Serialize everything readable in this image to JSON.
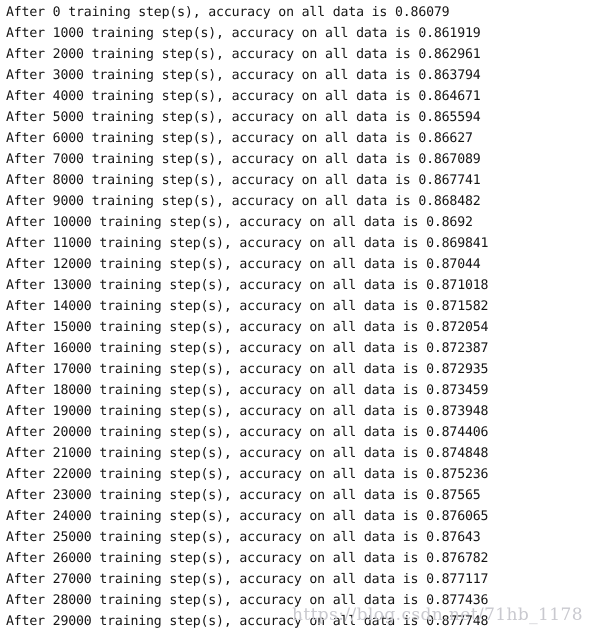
{
  "console": {
    "prefix": "After ",
    "middle": " training step(s), accuracy on all data is ",
    "lines": [
      "After 0 training step(s), accuracy on all data is 0.86079",
      "After 1000 training step(s), accuracy on all data is 0.861919",
      "After 2000 training step(s), accuracy on all data is 0.862961",
      "After 3000 training step(s), accuracy on all data is 0.863794",
      "After 4000 training step(s), accuracy on all data is 0.864671",
      "After 5000 training step(s), accuracy on all data is 0.865594",
      "After 6000 training step(s), accuracy on all data is 0.86627",
      "After 7000 training step(s), accuracy on all data is 0.867089",
      "After 8000 training step(s), accuracy on all data is 0.867741",
      "After 9000 training step(s), accuracy on all data is 0.868482",
      "After 10000 training step(s), accuracy on all data is 0.8692",
      "After 11000 training step(s), accuracy on all data is 0.869841",
      "After 12000 training step(s), accuracy on all data is 0.87044",
      "After 13000 training step(s), accuracy on all data is 0.871018",
      "After 14000 training step(s), accuracy on all data is 0.871582",
      "After 15000 training step(s), accuracy on all data is 0.872054",
      "After 16000 training step(s), accuracy on all data is 0.872387",
      "After 17000 training step(s), accuracy on all data is 0.872935",
      "After 18000 training step(s), accuracy on all data is 0.873459",
      "After 19000 training step(s), accuracy on all data is 0.873948",
      "After 20000 training step(s), accuracy on all data is 0.874406",
      "After 21000 training step(s), accuracy on all data is 0.874848",
      "After 22000 training step(s), accuracy on all data is 0.875236",
      "After 23000 training step(s), accuracy on all data is 0.87565",
      "After 24000 training step(s), accuracy on all data is 0.876065",
      "After 25000 training step(s), accuracy on all data is 0.87643",
      "After 26000 training step(s), accuracy on all data is 0.876782",
      "After 27000 training step(s), accuracy on all data is 0.877117",
      "After 28000 training step(s), accuracy on all data is 0.877436",
      "After 29000 training step(s), accuracy on all data is 0.877748"
    ],
    "steps": [
      0,
      1000,
      2000,
      3000,
      4000,
      5000,
      6000,
      7000,
      8000,
      9000,
      10000,
      11000,
      12000,
      13000,
      14000,
      15000,
      16000,
      17000,
      18000,
      19000,
      20000,
      21000,
      22000,
      23000,
      24000,
      25000,
      26000,
      27000,
      28000,
      29000
    ],
    "accuracies": [
      0.86079,
      0.861919,
      0.862961,
      0.863794,
      0.864671,
      0.865594,
      0.86627,
      0.867089,
      0.867741,
      0.868482,
      0.8692,
      0.869841,
      0.87044,
      0.871018,
      0.871582,
      0.872054,
      0.872387,
      0.872935,
      0.873459,
      0.873948,
      0.874406,
      0.874848,
      0.875236,
      0.87565,
      0.876065,
      0.87643,
      0.876782,
      0.877117,
      0.877436,
      0.877748
    ]
  },
  "watermark": {
    "text": "https://blog.csdn.net/71hb_1178"
  },
  "colors": {
    "background": "#ffffff",
    "text": "#141414",
    "watermark": "#c9c9cf"
  }
}
